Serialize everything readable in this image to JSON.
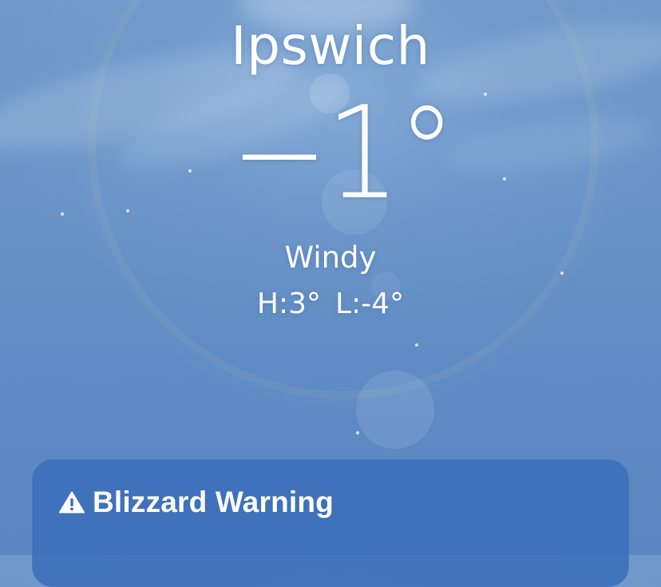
{
  "location": {
    "city": "Ipswich"
  },
  "current": {
    "temperature": "−1°",
    "condition": "Windy",
    "high": "H:3°",
    "low": "L:-4°"
  },
  "alert": {
    "icon": "warning-triangle-icon",
    "title": "Blizzard Warning"
  },
  "colors": {
    "sky_top": "#6f99c9",
    "sky_bottom": "#5a86c1",
    "card_background": "#3c6eb9",
    "text": "#ffffff"
  }
}
